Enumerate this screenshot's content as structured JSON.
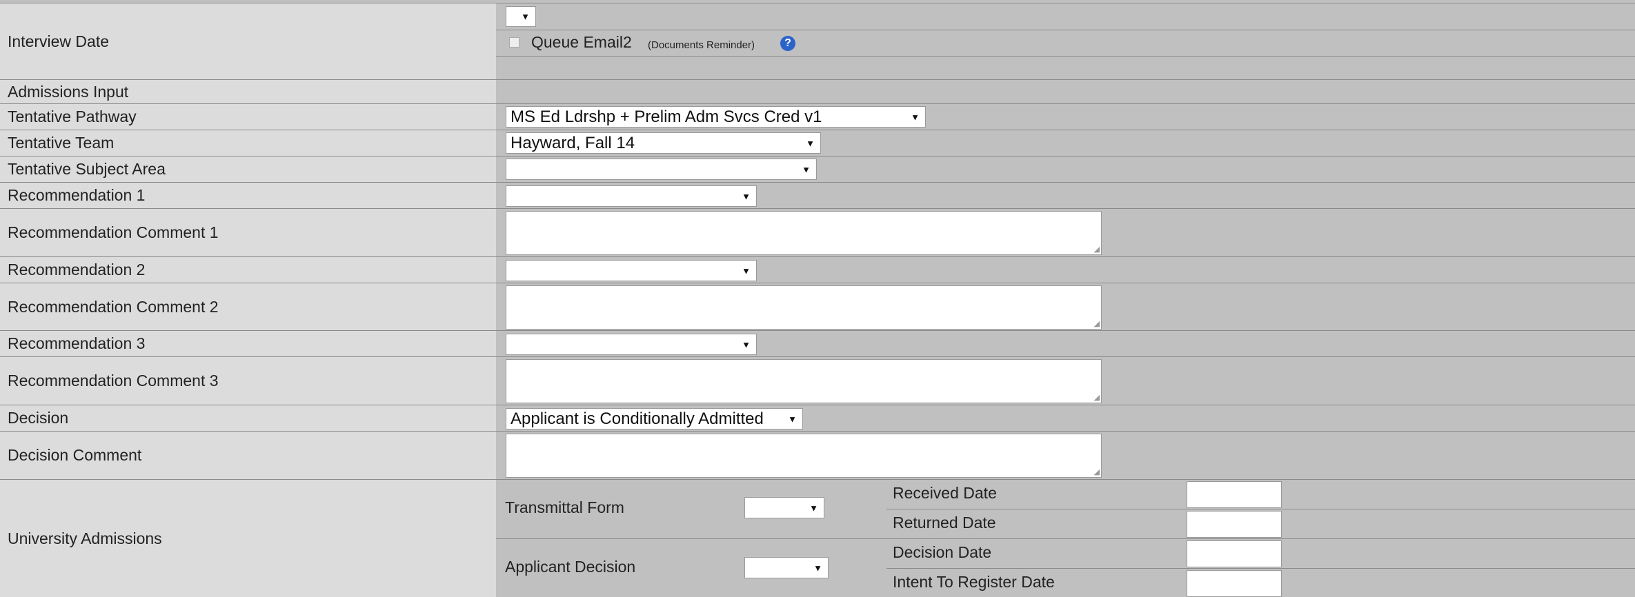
{
  "interview": {
    "label": "Interview Date",
    "queue_label": "Queue Email2",
    "queue_note": "(Documents Reminder)",
    "help": "?"
  },
  "admissions_input": "Admissions Input",
  "pathway": {
    "label": "Tentative Pathway",
    "value": "MS Ed Ldrshp + Prelim Adm Svcs Cred v1"
  },
  "team": {
    "label": "Tentative Team",
    "value": "Hayward, Fall 14"
  },
  "subject": {
    "label": "Tentative Subject Area",
    "value": ""
  },
  "rec1": {
    "label": "Recommendation 1",
    "value": ""
  },
  "rec1_comment": {
    "label": "Recommendation Comment 1"
  },
  "rec2": {
    "label": "Recommendation 2",
    "value": ""
  },
  "rec2_comment": {
    "label": "Recommendation Comment 2"
  },
  "rec3": {
    "label": "Recommendation 3",
    "value": ""
  },
  "rec3_comment": {
    "label": "Recommendation Comment 3"
  },
  "decision": {
    "label": "Decision",
    "value": "Applicant is Conditionally Admitted"
  },
  "decision_comment": {
    "label": "Decision Comment"
  },
  "university": {
    "label": "University Admissions",
    "transmittal_label": "Transmittal Form",
    "applicant_decision_label": "Applicant Decision",
    "received_date": "Received Date",
    "returned_date": "Returned Date",
    "decision_date": "Decision Date",
    "intent_date": "Intent To Register Date"
  },
  "arrow": "▼",
  "grip": "◢"
}
